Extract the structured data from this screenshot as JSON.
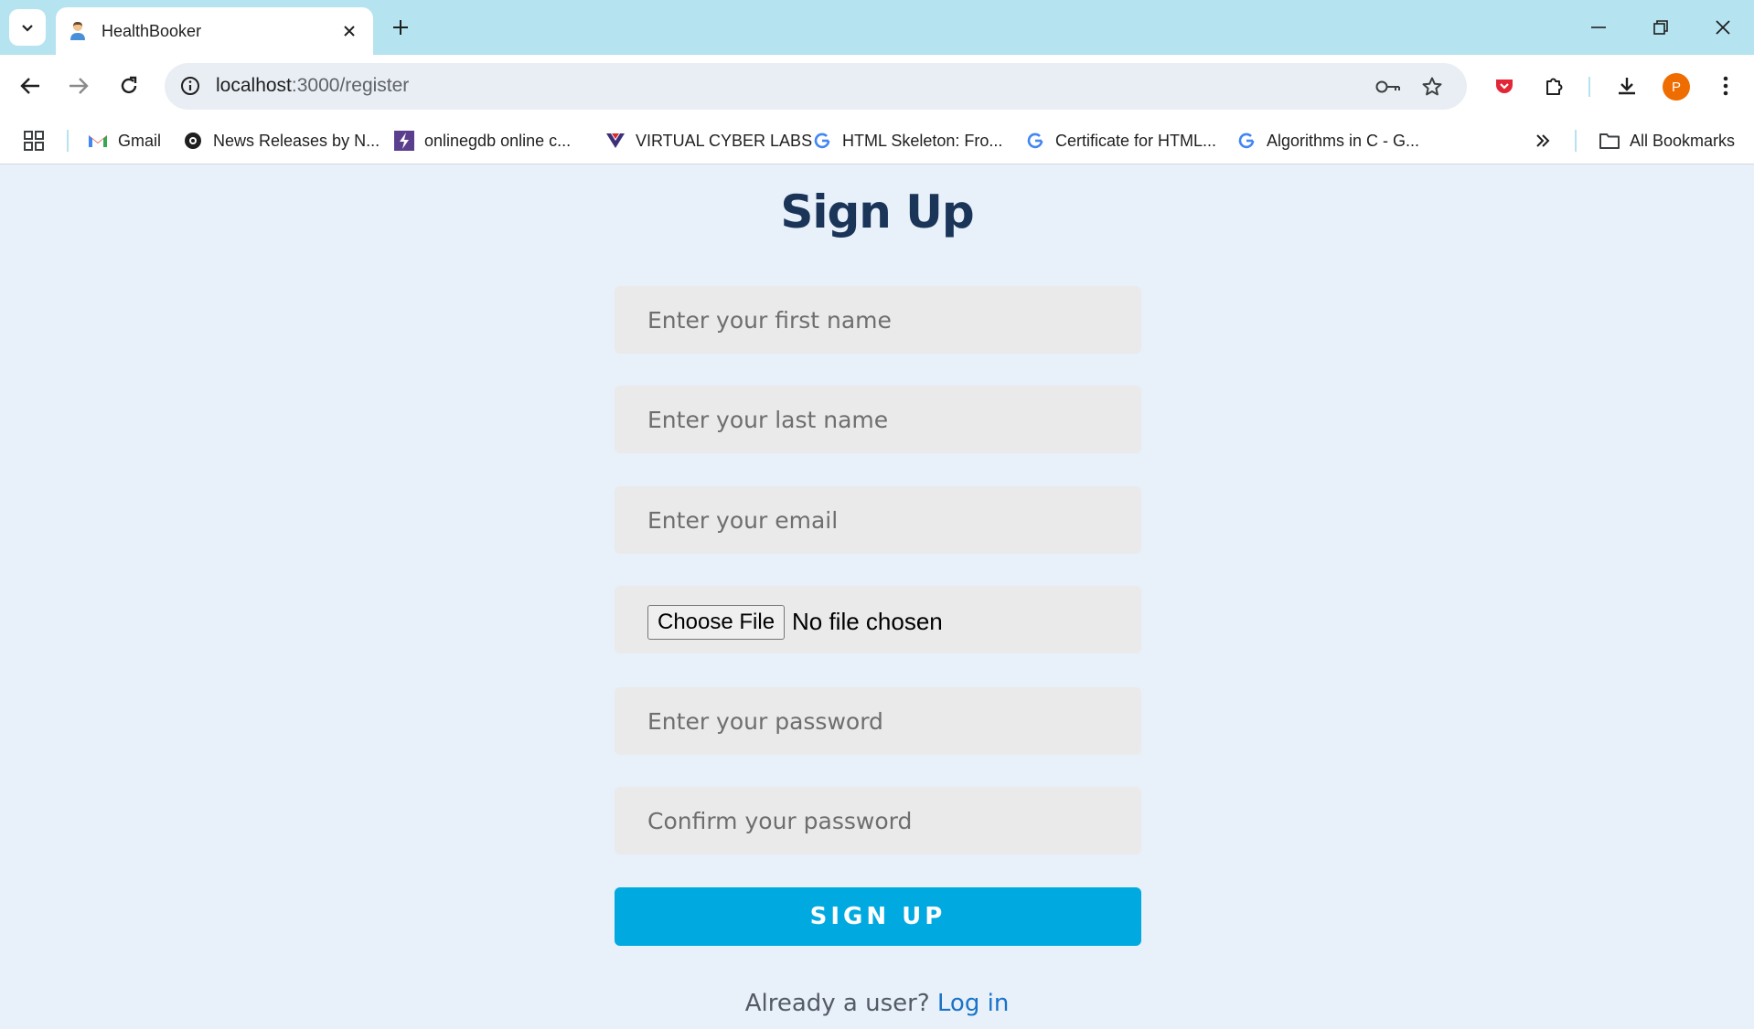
{
  "browser": {
    "tab": {
      "title": "HealthBooker"
    },
    "address_bar": {
      "host": "localhost",
      "path": ":3000/register"
    },
    "profile_initial": "P",
    "bookmarks": [
      {
        "label": "Gmail",
        "icon": "gmail-icon"
      },
      {
        "label": "News Releases by N...",
        "icon": "news-icon"
      },
      {
        "label": "onlinegdb online c...",
        "icon": "onlinegdb-icon"
      },
      {
        "label": "VIRTUAL CYBER LABS",
        "icon": "cyberlabs-icon"
      },
      {
        "label": "HTML Skeleton: Fro...",
        "icon": "google-icon"
      },
      {
        "label": "Certificate for HTML...",
        "icon": "google-icon"
      },
      {
        "label": "Algorithms in C - G...",
        "icon": "google-icon"
      }
    ],
    "all_bookmarks_label": "All Bookmarks"
  },
  "form": {
    "title": "Sign Up",
    "first_name": {
      "placeholder": "Enter your first name",
      "value": ""
    },
    "last_name": {
      "placeholder": "Enter your last name",
      "value": ""
    },
    "email": {
      "placeholder": "Enter your email",
      "value": ""
    },
    "file": {
      "button_label": "Choose File",
      "status": "No file chosen"
    },
    "password": {
      "placeholder": "Enter your password",
      "value": ""
    },
    "confirm_password": {
      "placeholder": "Confirm your password",
      "value": ""
    },
    "submit_label": "SIGN UP",
    "login_prompt": "Already a user?",
    "login_link": "Log in"
  },
  "colors": {
    "page_background": "#e8f0fa",
    "heading": "#1a3558",
    "button": "#00a9e0",
    "link": "#1a73c8",
    "tab_strip": "#b5e3f0"
  }
}
